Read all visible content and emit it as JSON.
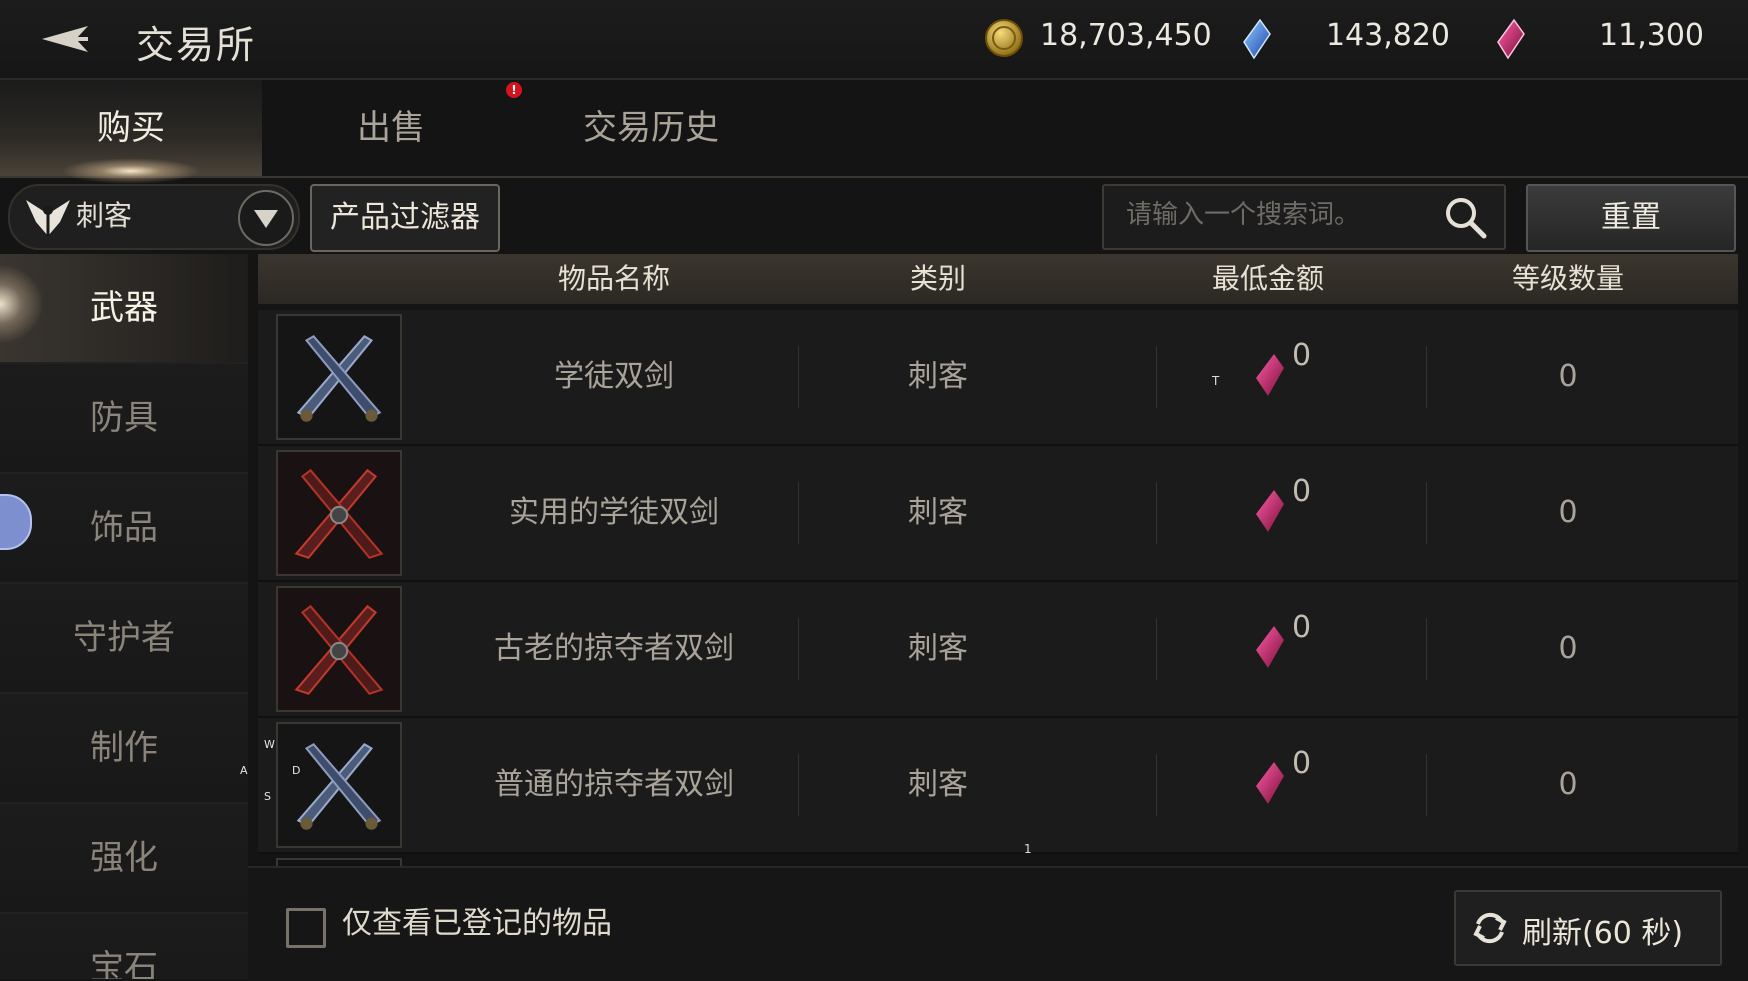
{
  "header": {
    "title": "交易所",
    "currencies": [
      {
        "icon": "gold-coin-icon",
        "value": "18,703,450"
      },
      {
        "icon": "blue-crystal-icon",
        "value": "143,820"
      },
      {
        "icon": "pink-crystal-icon",
        "value": "11,300"
      }
    ]
  },
  "tabs": [
    {
      "label": "购买",
      "active": true
    },
    {
      "label": "出售",
      "active": false,
      "alert": "!"
    },
    {
      "label": "交易历史",
      "active": false
    }
  ],
  "filters": {
    "class_label": "刺客",
    "product_filter_label": "产品过滤器",
    "search_placeholder": "请输入一个搜索词。",
    "reset_label": "重置"
  },
  "sidebar": {
    "categories": [
      "武器",
      "防具",
      "饰品",
      "守护者",
      "制作",
      "强化",
      "宝石"
    ],
    "active_index": 0
  },
  "table": {
    "columns": [
      "物品名称",
      "类别",
      "最低金额",
      "等级数量"
    ],
    "rows": [
      {
        "name": "学徒双剑",
        "category": "刺客",
        "min_price": "0",
        "count": "0",
        "icon": "dual-swords-blue-icon"
      },
      {
        "name": "实用的学徒双剑",
        "category": "刺客",
        "min_price": "0",
        "count": "0",
        "icon": "dual-swords-red-icon"
      },
      {
        "name": "古老的掠夺者双剑",
        "category": "刺客",
        "min_price": "0",
        "count": "0",
        "icon": "dual-swords-red-icon"
      },
      {
        "name": "普通的掠夺者双剑",
        "category": "刺客",
        "min_price": "0",
        "count": "0",
        "icon": "dual-swords-blue-icon"
      }
    ]
  },
  "overlay": {
    "joypad_keys": [
      "W",
      "A",
      "D",
      "S"
    ],
    "page_marker": "1",
    "t_marker": "T"
  },
  "footer": {
    "checkbox_label": "仅查看已登记的物品",
    "checkbox_checked": false,
    "refresh_label": "刷新(60 秒)"
  },
  "colors": {
    "accent_active": "#f1ecdf",
    "alert": "#d3141d",
    "pink_gem": "#c2185b",
    "blue_gem": "#3b82f6",
    "gold": "#c9a227"
  }
}
